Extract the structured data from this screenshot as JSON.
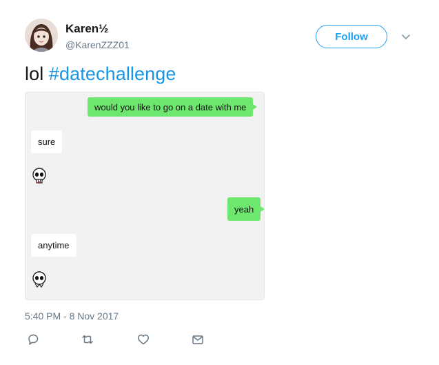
{
  "user": {
    "name": "Karen½",
    "handle": "@KarenZZZ01",
    "avatar_icon": "avatar-cartoon-girl"
  },
  "follow_button": {
    "label": "Follow"
  },
  "menu_icon": "chevron-down-icon",
  "tweet": {
    "text": "lol ",
    "hashtag": "#datechallenge"
  },
  "media": {
    "messages": [
      {
        "side": "out",
        "text": "would you like to go on a date with me"
      },
      {
        "side": "in",
        "text": "sure"
      },
      {
        "side": "out",
        "text": "yeah"
      },
      {
        "side": "in",
        "text": "anytime"
      }
    ],
    "sticker_icon": "skull-sticker-icon"
  },
  "timestamp": "5:40 PM - 8 Nov 2017",
  "actions": [
    "reply-icon",
    "retweet-icon",
    "like-icon",
    "direct-message-icon"
  ],
  "colors": {
    "accent": "#1da1f2",
    "hashtag": "#1b95e0",
    "outgoing_bubble": "#6de76d",
    "muted_text": "#657786"
  }
}
